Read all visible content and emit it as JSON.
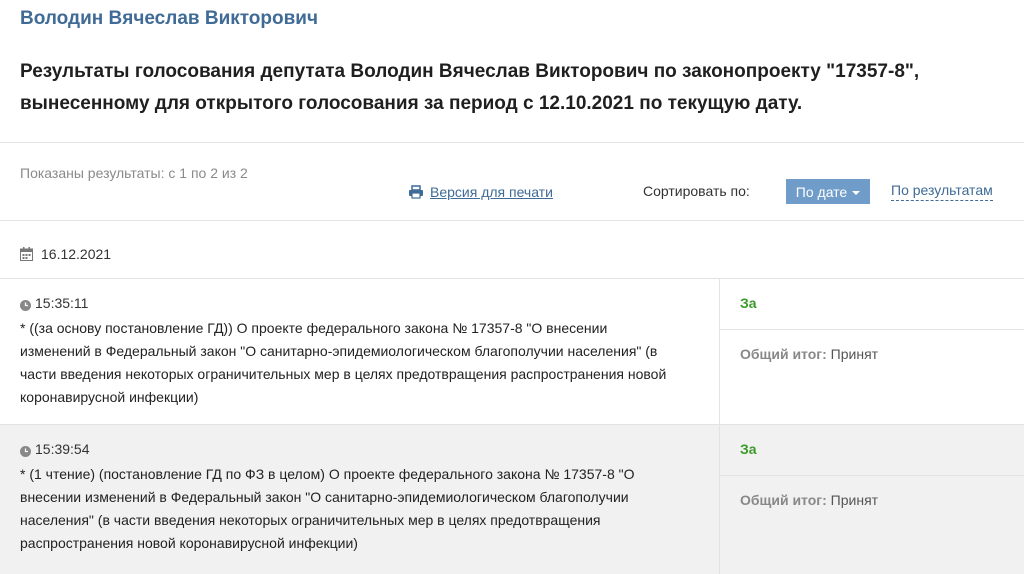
{
  "deputy_name": "Володин Вячеслав Викторович",
  "page_title": "Результаты голосования депутата Володин Вячеслав Викторович по законопроекту \"17357-8\", вынесенному для открытого голосования за период с 12.10.2021 по текущую дату.",
  "results_count": "Показаны результаты: с 1 по 2 из 2",
  "print_link": "Версия для печати",
  "sort": {
    "label": "Сортировать по:",
    "by_date": "По дате",
    "by_results": "По результатам"
  },
  "date_group": "16.12.2021",
  "votes": [
    {
      "time": "15:35:11",
      "description": "* ((за основу постановление ГД)) О проекте федерального закона № 17357-8 \"О внесении изменений в Федеральный закон \"О санитарно-эпидемиологическом благополучии населения\" (в части введения некоторых ограничительных мер в целях предотвращения распространения новой коронавирусной инфекции)",
      "result": "За",
      "total_label": "Общий итог:",
      "total_value": "Принят"
    },
    {
      "time": "15:39:54",
      "description": "* (1 чтение) (постановление ГД по ФЗ в целом) О проекте федерального закона № 17357-8 \"О внесении изменений в Федеральный закон \"О санитарно-эпидемиологическом благополучии населения\" (в части введения некоторых ограничительных мер в целях предотвращения распространения новой коронавирусной инфекции)",
      "result": "За",
      "total_label": "Общий итог:",
      "total_value": "Принят"
    }
  ],
  "colors": {
    "accent": "#3f6b96",
    "sort_active_bg": "#6f9cc9",
    "vote_for": "#3b9a2a"
  }
}
